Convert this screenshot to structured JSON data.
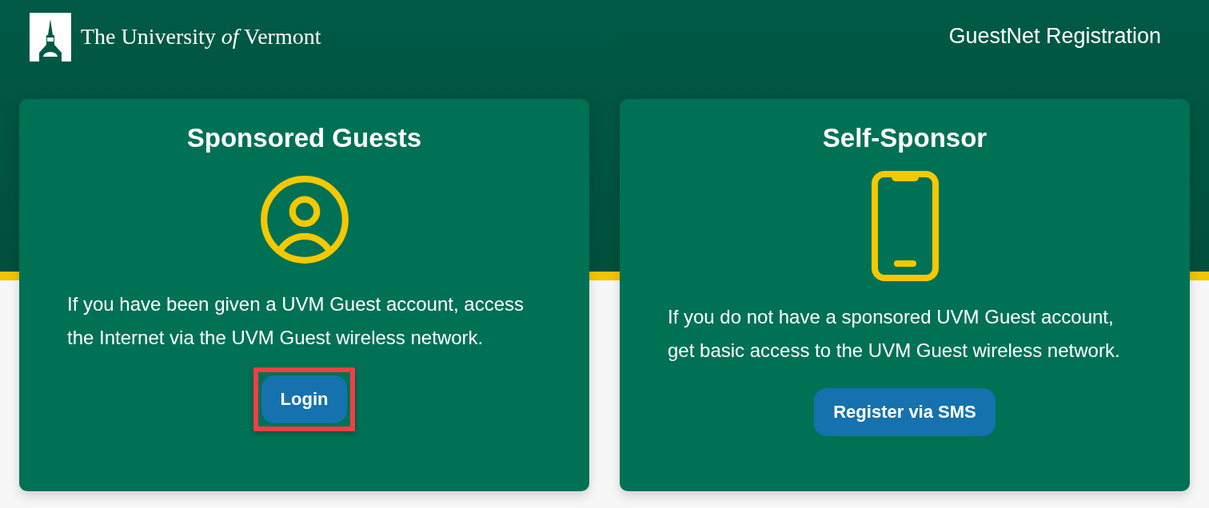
{
  "header": {
    "logo_text": "The University *of* Vermont",
    "title": "GuestNet Registration"
  },
  "cards": [
    {
      "title": "Sponsored Guests",
      "kind": "user",
      "description": "If you have been given a UVM Guest account, access the Internet via the UVM Guest wireless network.",
      "button": {
        "label": "Login",
        "highlighted": true
      }
    },
    {
      "title": "Self-Sponsor",
      "kind": "phone",
      "description": "If you do not have a sponsored UVM Guest account, get basic access to the UVM Guest wireless network.",
      "button": {
        "label": "Register via SMS",
        "highlighted": false
      }
    }
  ]
}
